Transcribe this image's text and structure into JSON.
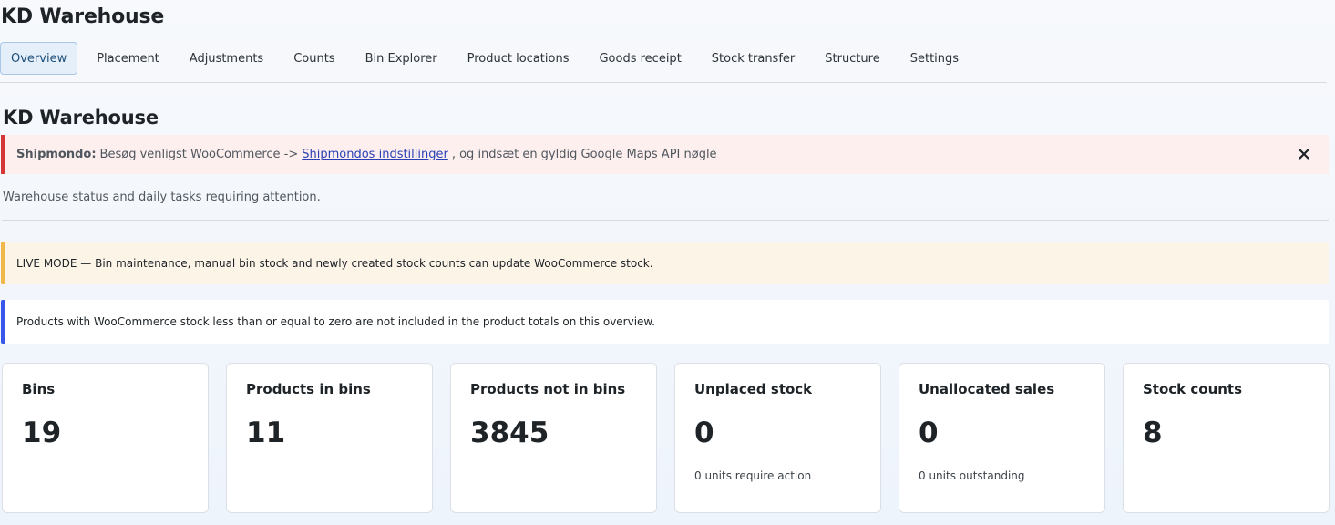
{
  "app": {
    "title": "KD Warehouse"
  },
  "tabs": [
    {
      "label": "Overview",
      "active": true
    },
    {
      "label": "Placement"
    },
    {
      "label": "Adjustments"
    },
    {
      "label": "Counts"
    },
    {
      "label": "Bin Explorer"
    },
    {
      "label": "Product locations"
    },
    {
      "label": "Goods receipt"
    },
    {
      "label": "Stock transfer"
    },
    {
      "label": "Structure"
    },
    {
      "label": "Settings"
    }
  ],
  "page": {
    "title": "KD Warehouse",
    "subtitle": "Warehouse status and daily tasks requiring attention."
  },
  "notice_error": {
    "label": "Shipmondo:",
    "text_before": "Besøg venligst WooCommerce ->",
    "link_text": "Shipmondos indstillinger",
    "text_after": ", og indsæt en gyldig Google Maps API nøgle",
    "dismiss_icon": "close-icon",
    "color": "#d63638"
  },
  "notice_warning": {
    "text": "LIVE MODE — Bin maintenance, manual bin stock and newly created stock counts can update WooCommerce stock.",
    "color": "#f0b849"
  },
  "notice_info": {
    "text": "Products with WooCommerce stock less than or equal to zero are not included in the product totals on this overview.",
    "color": "#3858e9"
  },
  "cards": [
    {
      "title": "Bins",
      "value": "19",
      "note": ""
    },
    {
      "title": "Products in bins",
      "value": "11",
      "note": ""
    },
    {
      "title": "Products not in bins",
      "value": "3845",
      "note": ""
    },
    {
      "title": "Unplaced stock",
      "value": "0",
      "note": "0 units require action"
    },
    {
      "title": "Unallocated sales",
      "value": "0",
      "note": "0 units outstanding"
    },
    {
      "title": "Stock counts",
      "value": "8",
      "note": ""
    }
  ]
}
